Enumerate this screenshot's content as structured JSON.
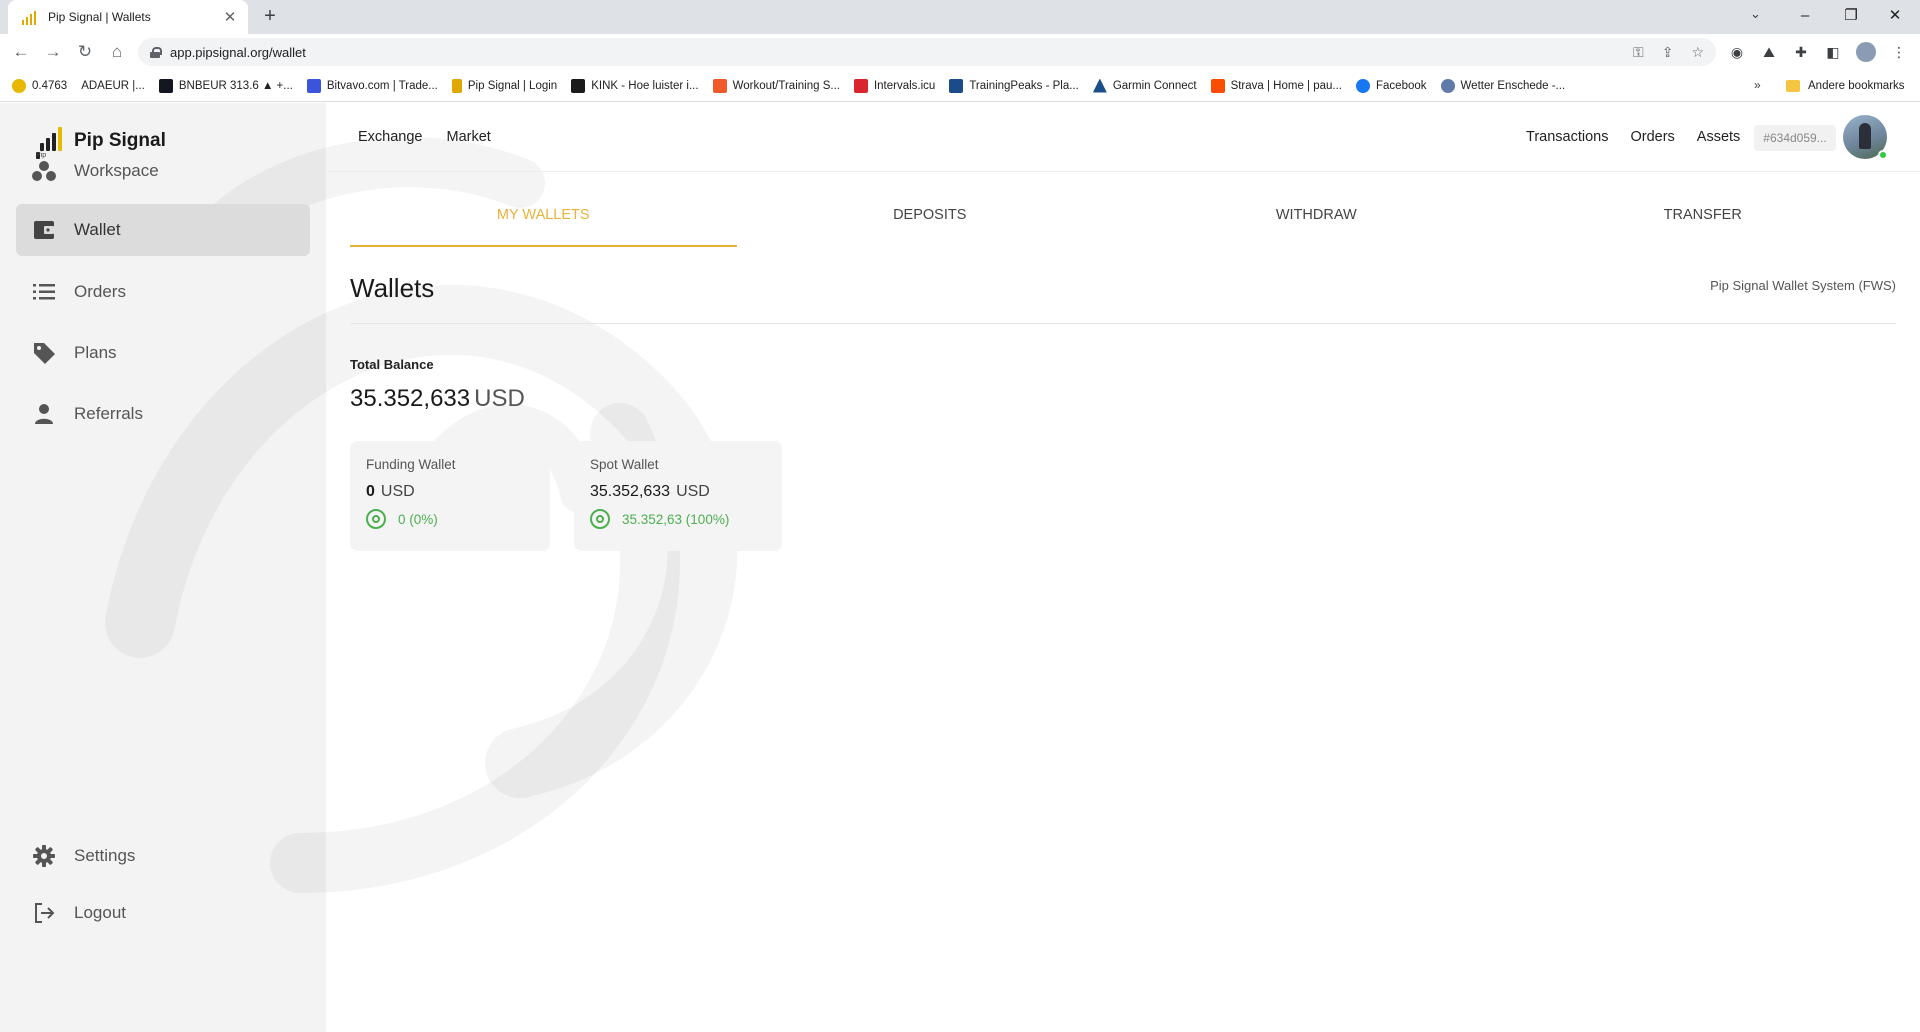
{
  "browser": {
    "tab_title": "Pip Signal | Wallets",
    "tab_close": "✕",
    "new_tab": "+",
    "url": "app.pipsignal.org/wallet",
    "controls": {
      "minimize": "–",
      "restore": "❐",
      "close": "✕",
      "tab_search": "⌄"
    },
    "nav": {
      "back": "←",
      "forward": "→",
      "reload": "↻",
      "home": "⌂"
    },
    "bookmarks": [
      {
        "label": "0.4763",
        "color": "#e6b800"
      },
      {
        "label": "ADAEUR |...",
        "color": "#ffffff"
      },
      {
        "label": "BNBEUR 313.6 ▲ +...",
        "color": "#131722"
      },
      {
        "label": "Bitvavo.com | Trade...",
        "color": "#3a55d9"
      },
      {
        "label": "Pip Signal | Login",
        "color": "#e0a800"
      },
      {
        "label": "KINK - Hoe luister i...",
        "color": "#1b1b1b"
      },
      {
        "label": "Workout/Training S...",
        "color": "#f05a28"
      },
      {
        "label": "Intervals.icu",
        "color": "#d8262f"
      },
      {
        "label": "TrainingPeaks - Pla...",
        "color": "#1a4c8b"
      },
      {
        "label": "Garmin Connect",
        "color": "#1b4f8a"
      },
      {
        "label": "Strava | Home | pau...",
        "color": "#fc4c02"
      },
      {
        "label": "Facebook",
        "color": "#1877f2"
      },
      {
        "label": "Wetter Enschede -...",
        "color": "#5f7aa8"
      }
    ],
    "bookmarks_more": "»",
    "other_bookmarks": "Andere bookmarks"
  },
  "app": {
    "brand": "Pip Signal",
    "brand_small": "Pip",
    "sidebar": {
      "items": [
        {
          "label": "Workspace",
          "icon": "workspace-icon"
        },
        {
          "label": "Wallet",
          "icon": "wallet-icon",
          "active": true
        },
        {
          "label": "Orders",
          "icon": "list-icon"
        },
        {
          "label": "Plans",
          "icon": "tag-icon"
        },
        {
          "label": "Referrals",
          "icon": "person-icon"
        }
      ],
      "bottom": [
        {
          "label": "Settings",
          "icon": "gear-icon"
        },
        {
          "label": "Logout",
          "icon": "logout-icon"
        }
      ]
    },
    "topnav": {
      "left": [
        "Exchange",
        "Market"
      ],
      "right": [
        "Transactions",
        "Orders",
        "Assets"
      ],
      "user_id": "#634d059..."
    },
    "tabs": [
      "MY WALLETS",
      "DEPOSITS",
      "WITHDRAW",
      "TRANSFER"
    ],
    "active_tab": 0,
    "heading": "Wallets",
    "system_label": "Pip Signal Wallet System (FWS)",
    "total": {
      "label": "Total Balance",
      "amount": "35.352,633",
      "currency": "USD"
    },
    "cards": [
      {
        "title": "Funding Wallet",
        "amount": "0",
        "currency": "USD",
        "sub": "0 (0%)"
      },
      {
        "title": "Spot Wallet",
        "amount": "35.352,633",
        "currency": "USD",
        "sub": "35.352,63 (100%)"
      }
    ],
    "colors": {
      "accent": "#e8b23a",
      "positive": "#4caf50",
      "sidebar_bg": "#f3f3f3",
      "active_item_bg": "#dcdcdc"
    }
  }
}
